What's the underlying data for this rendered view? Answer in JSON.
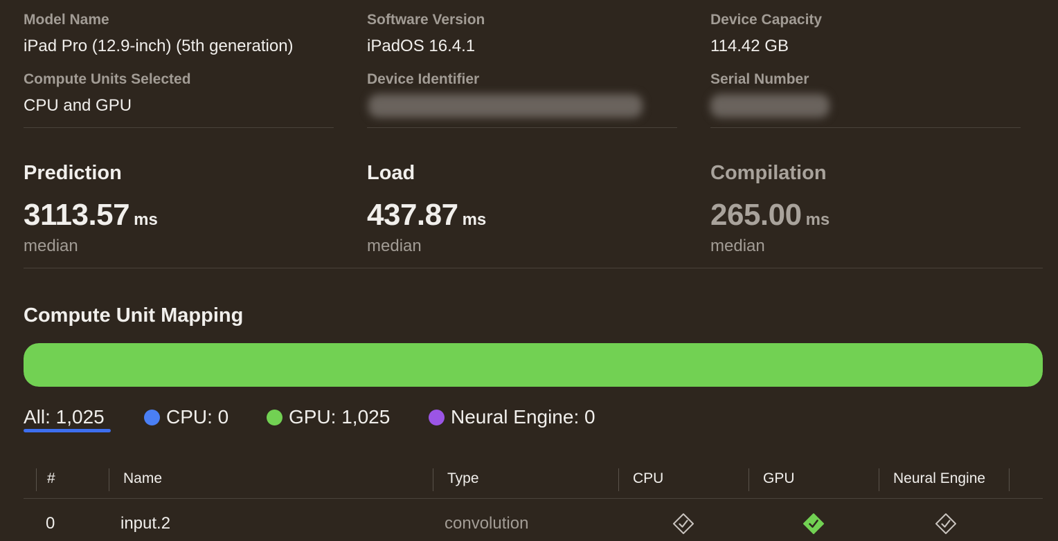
{
  "device": {
    "model_name": {
      "label": "Model Name",
      "value": "iPad Pro (12.9-inch) (5th generation)"
    },
    "software_version": {
      "label": "Software Version",
      "value": "iPadOS 16.4.1"
    },
    "device_capacity": {
      "label": "Device Capacity",
      "value": "114.42 GB"
    },
    "compute_units": {
      "label": "Compute Units Selected",
      "value": "CPU and GPU"
    },
    "device_identifier": {
      "label": "Device Identifier"
    },
    "serial_number": {
      "label": "Serial Number"
    }
  },
  "metrics": {
    "prediction": {
      "title": "Prediction",
      "value": "3113.57",
      "unit": "ms",
      "sub": "median"
    },
    "load": {
      "title": "Load",
      "value": "437.87",
      "unit": "ms",
      "sub": "median"
    },
    "compilation": {
      "title": "Compilation",
      "value": "265.00",
      "unit": "ms",
      "sub": "median"
    }
  },
  "mapping": {
    "title": "Compute Unit Mapping",
    "gpu_fraction": 1.0,
    "filters": {
      "all": "All: 1,025",
      "cpu": "CPU: 0",
      "gpu": "GPU: 1,025",
      "ane": "Neural Engine: 0"
    },
    "colors": {
      "cpu": "#4a7ff5",
      "gpu": "#72d153",
      "ane": "#9b55e6",
      "selected_underline": "#3d6ef0"
    }
  },
  "table": {
    "headers": {
      "index": "#",
      "name": "Name",
      "type": "Type",
      "cpu": "CPU",
      "gpu": "GPU",
      "ane": "Neural Engine"
    },
    "rows": [
      {
        "index": "0",
        "name": "input.2",
        "type": "convolution",
        "cpu_icon": "diamond-check-outline-icon",
        "gpu_icon": "diamond-check-filled-icon",
        "ane_icon": "diamond-check-outline-icon"
      }
    ]
  }
}
